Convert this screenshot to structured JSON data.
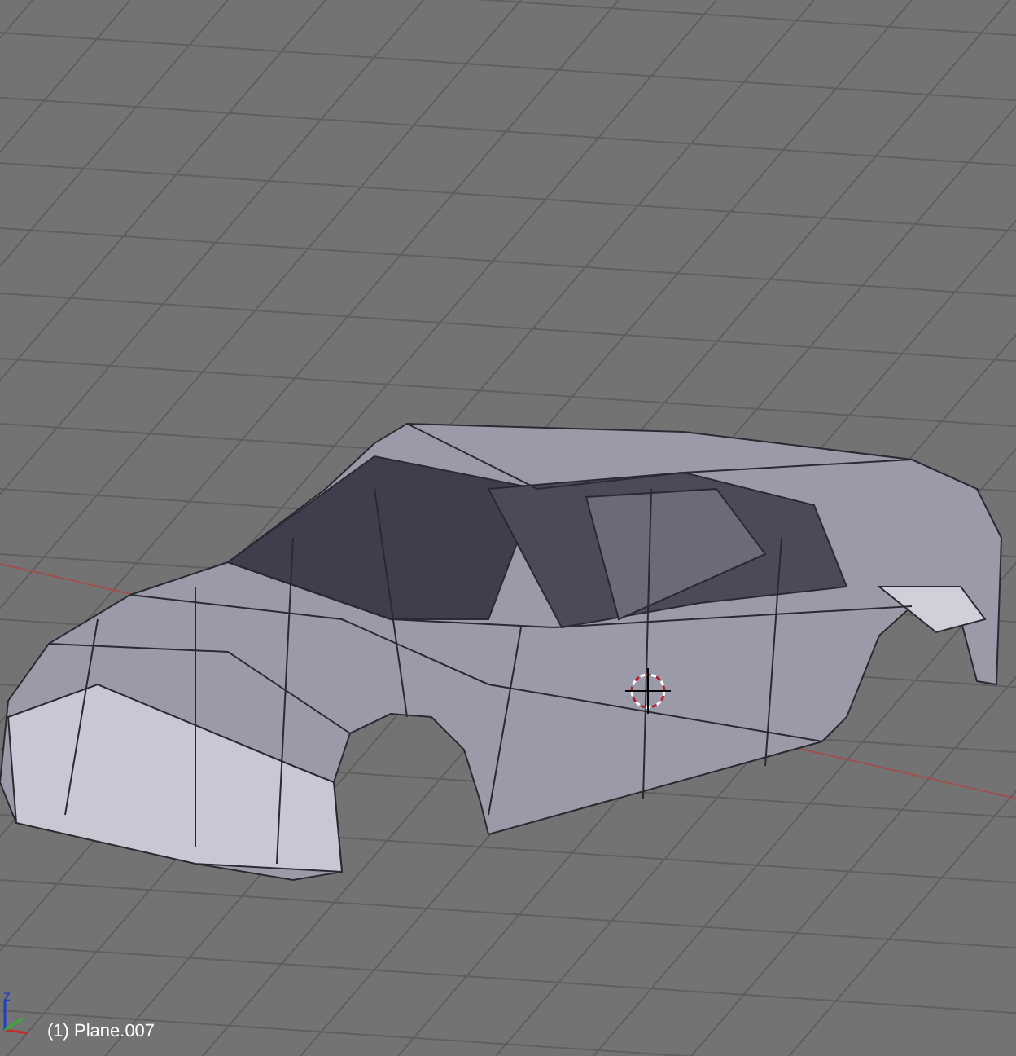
{
  "viewport": {
    "axis_label": "z",
    "object_info": "(1) Plane.007"
  }
}
